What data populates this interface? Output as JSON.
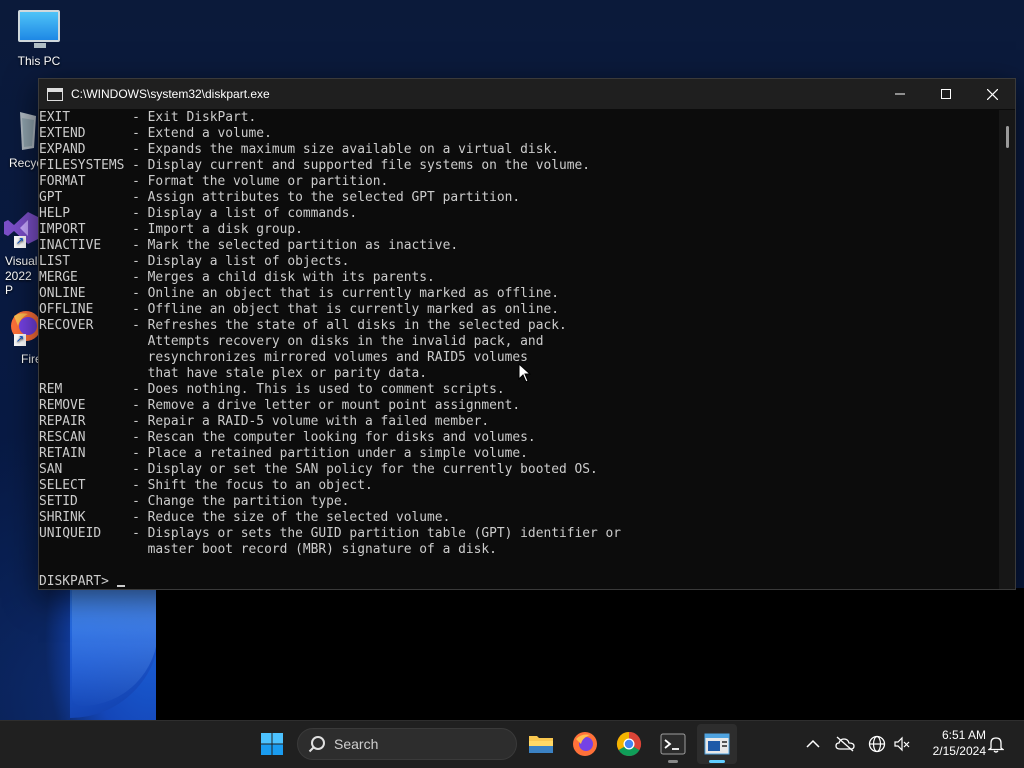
{
  "desktop": {
    "icons": [
      {
        "label": "This PC",
        "icon": "this-pc-icon"
      },
      {
        "label": "Recyc",
        "icon": "recycle-bin-icon"
      },
      {
        "label": "Visual",
        "label2": "2022 P",
        "icon": "visual-studio-icon"
      },
      {
        "label": "Fire",
        "icon": "firefox-icon"
      }
    ]
  },
  "window": {
    "title": "C:\\WINDOWS\\system32\\diskpart.exe",
    "buttons": {
      "minimize": "—",
      "maximize": "☐",
      "close": "✕"
    }
  },
  "console": {
    "lines": [
      "EXIT        - Exit DiskPart.",
      "EXTEND      - Extend a volume.",
      "EXPAND      - Expands the maximum size available on a virtual disk.",
      "FILESYSTEMS - Display current and supported file systems on the volume.",
      "FORMAT      - Format the volume or partition.",
      "GPT         - Assign attributes to the selected GPT partition.",
      "HELP        - Display a list of commands.",
      "IMPORT      - Import a disk group.",
      "INACTIVE    - Mark the selected partition as inactive.",
      "LIST        - Display a list of objects.",
      "MERGE       - Merges a child disk with its parents.",
      "ONLINE      - Online an object that is currently marked as offline.",
      "OFFLINE     - Offline an object that is currently marked as online.",
      "RECOVER     - Refreshes the state of all disks in the selected pack.",
      "              Attempts recovery on disks in the invalid pack, and",
      "              resynchronizes mirrored volumes and RAID5 volumes",
      "              that have stale plex or parity data.",
      "REM         - Does nothing. This is used to comment scripts.",
      "REMOVE      - Remove a drive letter or mount point assignment.",
      "REPAIR      - Repair a RAID-5 volume with a failed member.",
      "RESCAN      - Rescan the computer looking for disks and volumes.",
      "RETAIN      - Place a retained partition under a simple volume.",
      "SAN         - Display or set the SAN policy for the currently booted OS.",
      "SELECT      - Shift the focus to an object.",
      "SETID       - Change the partition type.",
      "SHRINK      - Reduce the size of the selected volume.",
      "UNIQUEID    - Displays or sets the GUID partition table (GPT) identifier or",
      "              master boot record (MBR) signature of a disk.",
      ""
    ],
    "prompt": "DISKPART> "
  },
  "taskbar": {
    "search_placeholder": "Search",
    "apps": [
      "start-icon",
      "file-explorer-icon",
      "firefox-icon",
      "chrome-icon",
      "terminal-icon",
      "diskpart-console-icon"
    ],
    "tray": [
      "chevron-up-icon",
      "onedrive-offline-icon",
      "language-globe-icon",
      "network-sound-icon",
      "notification-bell-icon"
    ],
    "time": "6:51 AM",
    "date": "2/15/2024"
  },
  "colors": {
    "console_bg": "#0c0c0c",
    "console_fg": "#cccccc",
    "titlebar_bg": "#1f1f1f",
    "taskbar_bg": "#202020",
    "accent": "#60cdff"
  }
}
